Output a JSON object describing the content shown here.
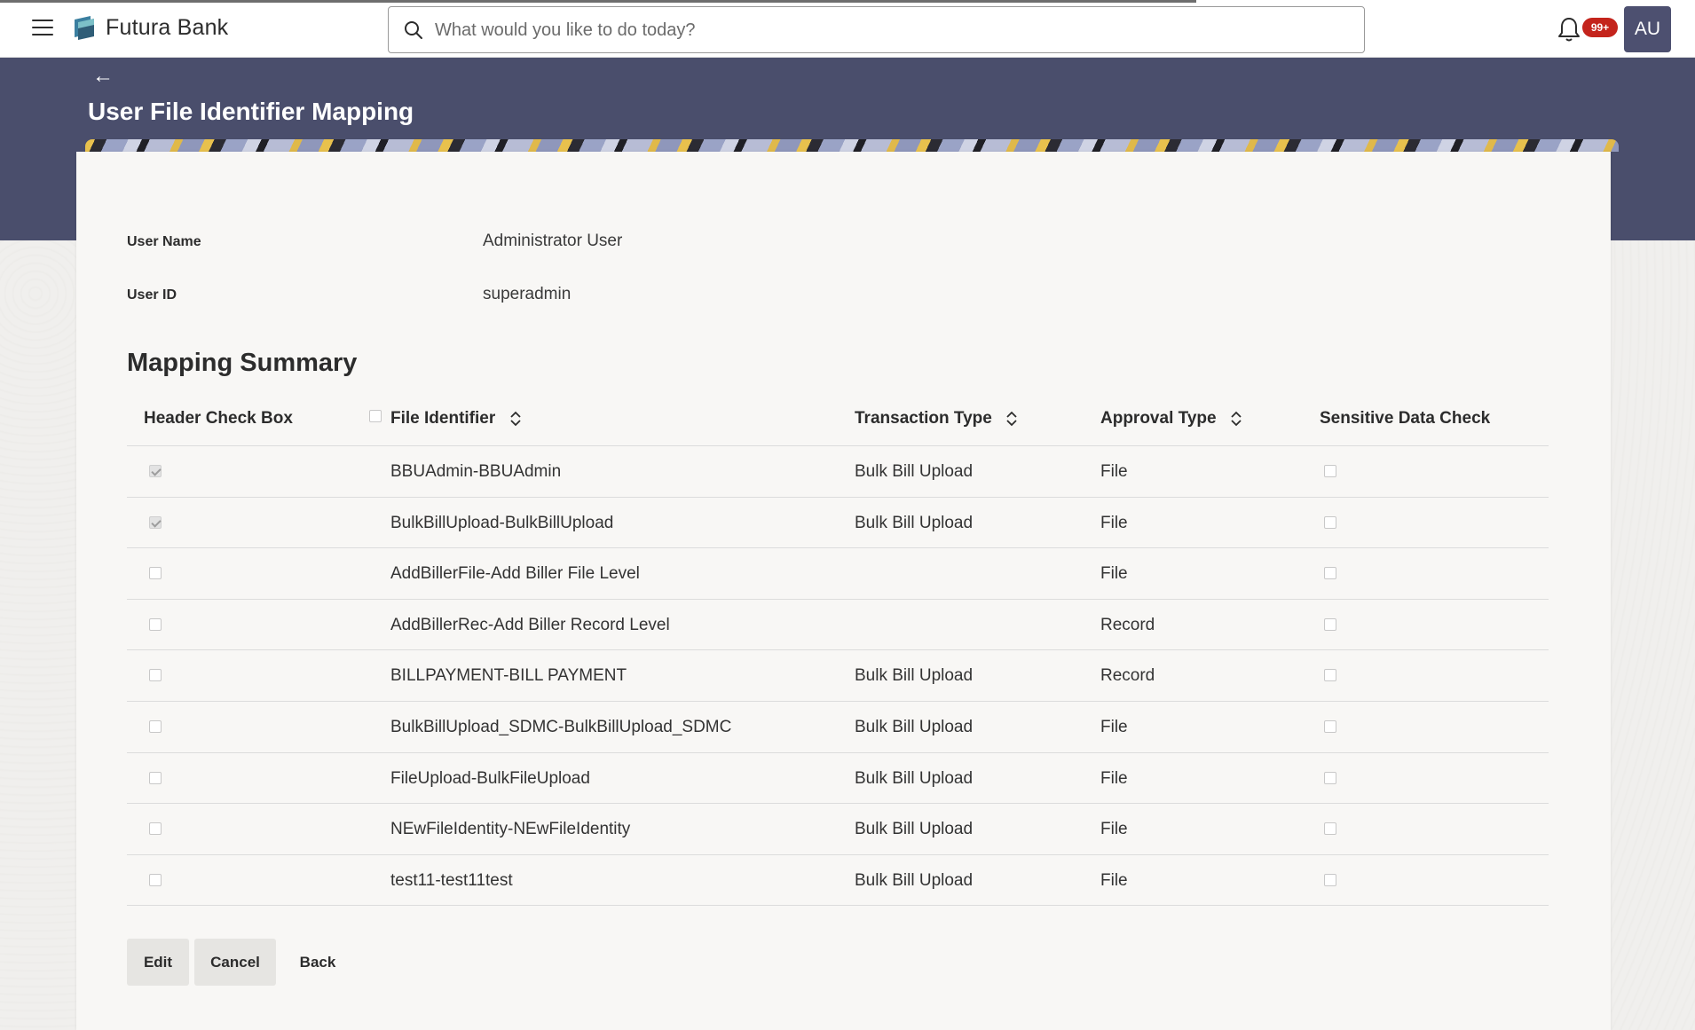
{
  "topbar": {
    "brand": "Futura Bank",
    "search_placeholder": "What would you like to do today?",
    "notification_count": "99+",
    "avatar_initials": "AU"
  },
  "page": {
    "title": "User File Identifier Mapping"
  },
  "user_info": {
    "user_name_label": "User Name",
    "user_name_value": "Administrator User",
    "user_id_label": "User ID",
    "user_id_value": "superadmin"
  },
  "summary": {
    "title": "Mapping Summary",
    "columns": {
      "header_check_box": "Header Check Box",
      "file_identifier": "File Identifier",
      "transaction_type": "Transaction Type",
      "approval_type": "Approval Type",
      "sensitive_data_check": "Sensitive Data Check"
    },
    "rows": [
      {
        "checked": true,
        "file_identifier": "BBUAdmin-BBUAdmin",
        "transaction_type": "Bulk Bill Upload",
        "approval_type": "File",
        "sensitive": false
      },
      {
        "checked": true,
        "file_identifier": "BulkBillUpload-BulkBillUpload",
        "transaction_type": "Bulk Bill Upload",
        "approval_type": "File",
        "sensitive": false
      },
      {
        "checked": false,
        "file_identifier": "AddBillerFile-Add Biller File Level",
        "transaction_type": "",
        "approval_type": "File",
        "sensitive": false
      },
      {
        "checked": false,
        "file_identifier": "AddBillerRec-Add Biller Record Level",
        "transaction_type": "",
        "approval_type": "Record",
        "sensitive": false
      },
      {
        "checked": false,
        "file_identifier": "BILLPAYMENT-BILL PAYMENT",
        "transaction_type": "Bulk Bill Upload",
        "approval_type": "Record",
        "sensitive": false
      },
      {
        "checked": false,
        "file_identifier": "BulkBillUpload_SDMC-BulkBillUpload_SDMC",
        "transaction_type": "Bulk Bill Upload",
        "approval_type": "File",
        "sensitive": false
      },
      {
        "checked": false,
        "file_identifier": "FileUpload-BulkFileUpload",
        "transaction_type": "Bulk Bill Upload",
        "approval_type": "File",
        "sensitive": false
      },
      {
        "checked": false,
        "file_identifier": "NEwFileIdentity-NEwFileIdentity",
        "transaction_type": "Bulk Bill Upload",
        "approval_type": "File",
        "sensitive": false
      },
      {
        "checked": false,
        "file_identifier": "test11-test11test",
        "transaction_type": "Bulk Bill Upload",
        "approval_type": "File",
        "sensitive": false
      }
    ]
  },
  "actions": {
    "edit_label": "Edit",
    "cancel_label": "Cancel",
    "back_label": "Back"
  },
  "icons": {
    "menu": "hamburger-menu-icon",
    "logo": "bank-logo-icon",
    "search": "search-icon",
    "bell": "bell-icon",
    "back": "back-arrow-icon",
    "sort": "sort-icon"
  },
  "colors": {
    "header_band": "#4a4e6c",
    "avatar": "#4d5070",
    "badge": "#c4241c"
  }
}
